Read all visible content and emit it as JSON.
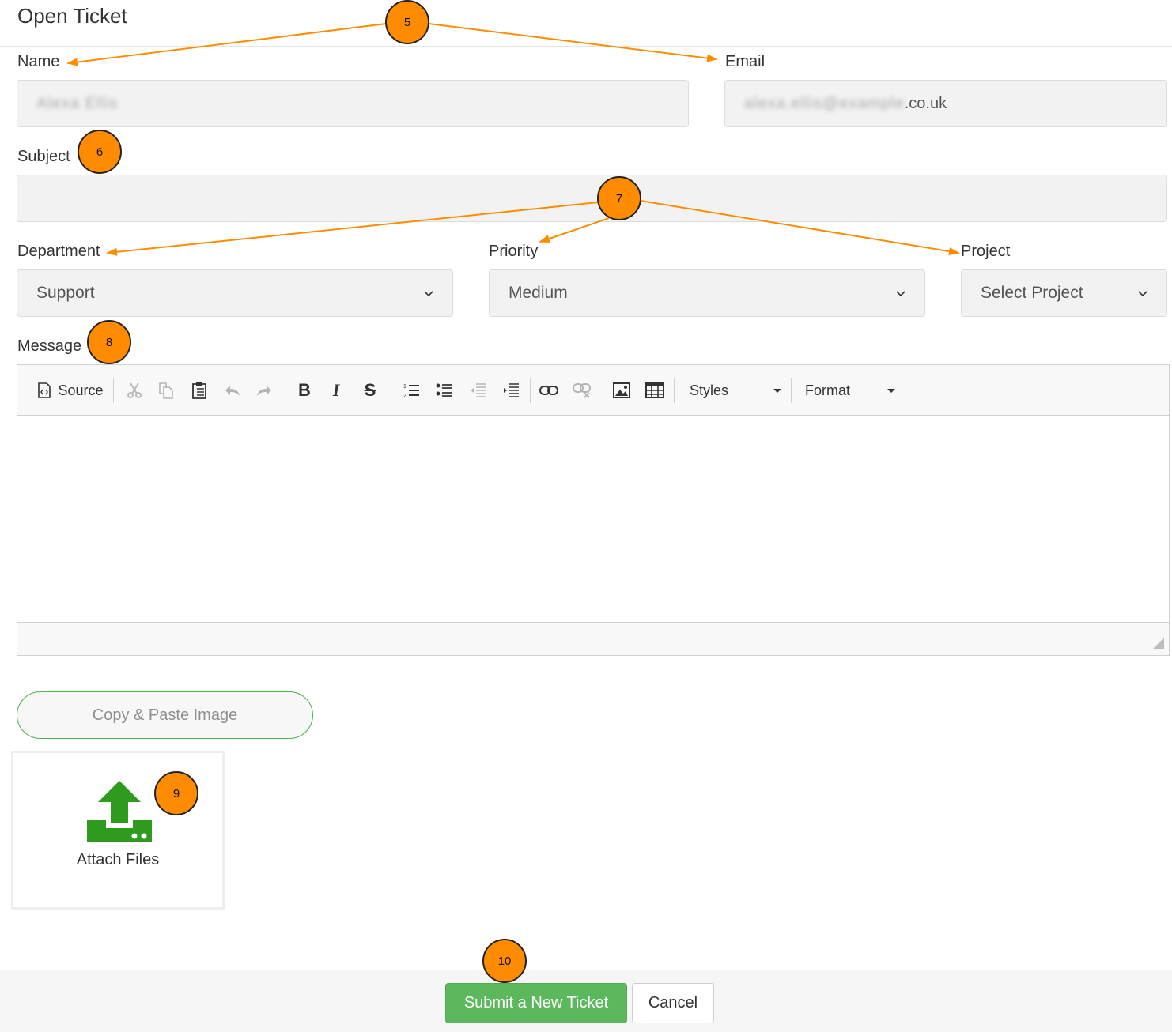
{
  "page": {
    "title": "Open Ticket"
  },
  "form": {
    "name_label": "Name",
    "name_value": "Alexa Ellis",
    "email_label": "Email",
    "email_value_hidden": "alexa.ellis@example",
    "email_value_visible": ".co.uk",
    "subject_label": "Subject",
    "subject_value": "",
    "department_label": "Department",
    "department_value": "Support",
    "priority_label": "Priority",
    "priority_value": "Medium",
    "project_label": "Project",
    "project_value": "Select Project",
    "message_label": "Message"
  },
  "editor": {
    "source_label": "Source",
    "styles_label": "Styles",
    "format_label": "Format",
    "icons": [
      "source-icon",
      "cut-icon",
      "copy-icon",
      "paste-icon",
      "undo-icon",
      "redo-icon",
      "bold-icon",
      "italic-icon",
      "strikethrough-icon",
      "numbered-list-icon",
      "bulleted-list-icon",
      "outdent-icon",
      "indent-icon",
      "link-icon",
      "unlink-icon",
      "image-icon",
      "table-icon"
    ]
  },
  "attachments": {
    "copy_paste_label": "Copy & Paste Image",
    "attach_label": "Attach Files",
    "attach_icon": "upload-icon",
    "icon_color": "#2e9b1f"
  },
  "actions": {
    "submit_label": "Submit a New Ticket",
    "cancel_label": "Cancel",
    "submit_color": "#5cb85c"
  },
  "annotations": {
    "color": "#ff8c00",
    "markers": [
      "5",
      "6",
      "7",
      "8",
      "9",
      "10"
    ]
  }
}
